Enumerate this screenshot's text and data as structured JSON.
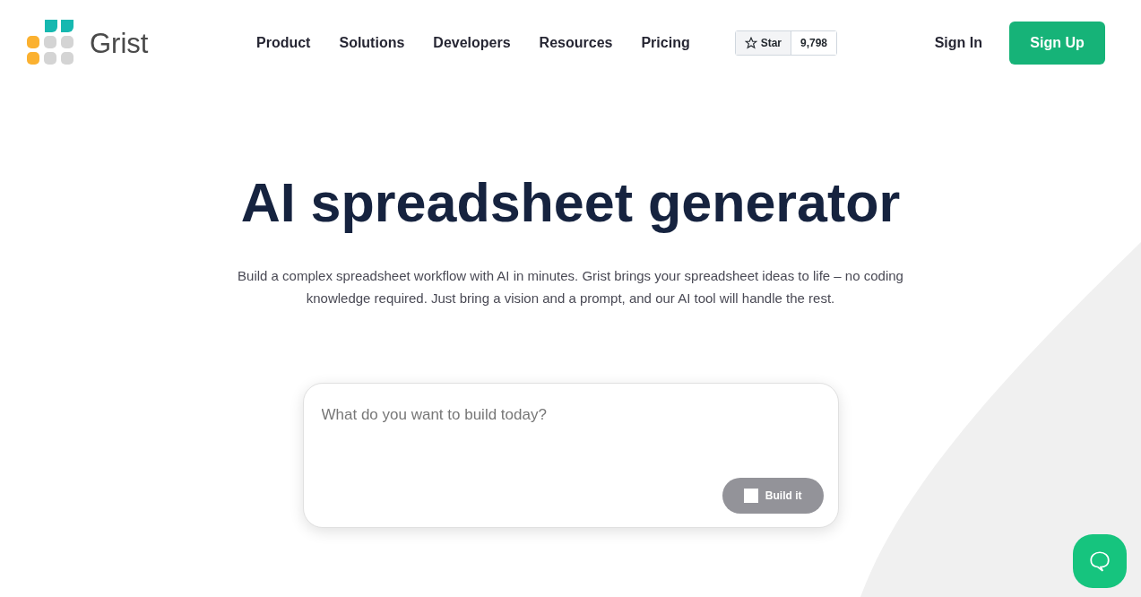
{
  "logo": {
    "text": "Grist"
  },
  "nav": {
    "items": [
      "Product",
      "Solutions",
      "Developers",
      "Resources",
      "Pricing"
    ]
  },
  "github": {
    "label": "Star",
    "count": "9,798"
  },
  "auth": {
    "sign_in": "Sign In",
    "sign_up": "Sign Up"
  },
  "hero": {
    "title": "AI spreadsheet generator",
    "subtitle": "Build a complex spreadsheet workflow with AI in minutes. Grist brings your spreadsheet ideas to life – no coding knowledge required. Just bring a vision and a prompt, and our AI tool will handle the rest."
  },
  "prompt": {
    "placeholder": "What do you want to build today?",
    "button": "Build it"
  }
}
